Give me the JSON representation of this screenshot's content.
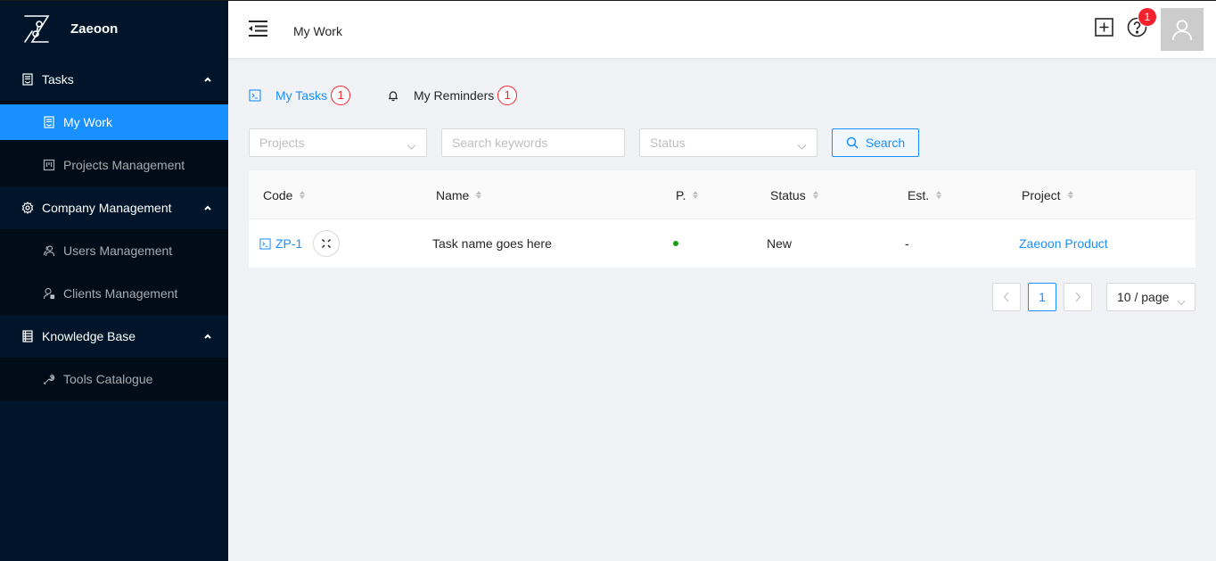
{
  "app": {
    "brand": "Zaeoon"
  },
  "sidebar": {
    "groups": [
      {
        "label": "Tasks",
        "icon": "task-doc-icon",
        "expanded": true,
        "items": [
          {
            "label": "My Work",
            "icon": "task-doc-icon",
            "active": true
          },
          {
            "label": "Projects Management",
            "icon": "board-icon",
            "active": false
          }
        ]
      },
      {
        "label": "Company Management",
        "icon": "gear-icon",
        "expanded": true,
        "items": [
          {
            "label": "Users Management",
            "icon": "users-icon",
            "active": false
          },
          {
            "label": "Clients Management",
            "icon": "client-icon",
            "active": false
          }
        ]
      },
      {
        "label": "Knowledge Base",
        "icon": "book-icon",
        "expanded": true,
        "items": [
          {
            "label": "Tools Catalogue",
            "icon": "wrench-icon",
            "active": false
          }
        ]
      }
    ]
  },
  "header": {
    "title": "My Work",
    "help_badge": "1"
  },
  "tabs": [
    {
      "label": "My Tasks",
      "badge": "1",
      "icon": "terminal-icon",
      "active": true
    },
    {
      "label": "My Reminders",
      "badge": "1",
      "icon": "bell-icon",
      "active": false
    }
  ],
  "filters": {
    "projects_placeholder": "Projects",
    "keywords_placeholder": "Search keywords",
    "status_placeholder": "Status",
    "search_label": "Search"
  },
  "table": {
    "columns": [
      "Code",
      "Name",
      "P.",
      "Status",
      "Est.",
      "Project"
    ],
    "rows": [
      {
        "code": "ZP-1",
        "name": "Task name goes here",
        "priority": "low",
        "priority_color": "#13a10e",
        "status": "New",
        "estimate": "-",
        "project": "Zaeoon Product"
      }
    ]
  },
  "pagination": {
    "current_page": "1",
    "page_size": "10 / page"
  },
  "colors": {
    "accent": "#1890ff",
    "sidebar_bg": "#001529",
    "badge_red": "#f5222d"
  }
}
